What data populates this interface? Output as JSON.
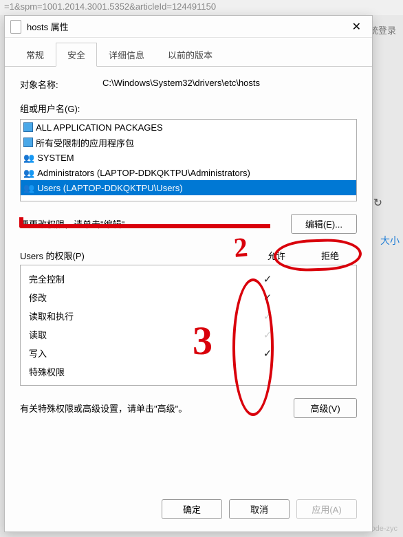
{
  "url_fragment": "=1&spm=1001.2014.3001.5352&articleId=124491150",
  "bg_login": "统登录",
  "bg_refresh_icon": "↻",
  "bg_size": "大小",
  "watermark": "CSDN @Code-zyc",
  "dialog": {
    "title": "hosts 属性",
    "close": "✕",
    "tabs": [
      {
        "label": "常规",
        "active": false
      },
      {
        "label": "安全",
        "active": true
      },
      {
        "label": "详细信息",
        "active": false
      },
      {
        "label": "以前的版本",
        "active": false
      }
    ],
    "object_label": "对象名称:",
    "object_value": "C:\\Windows\\System32\\drivers\\etc\\hosts",
    "group_label": "组或用户名(G):",
    "groups": [
      {
        "name": "ALL APPLICATION PACKAGES",
        "icon": "pkg",
        "selected": false
      },
      {
        "name": "所有受限制的应用程序包",
        "icon": "pkg",
        "selected": false
      },
      {
        "name": "SYSTEM",
        "icon": "user",
        "selected": false
      },
      {
        "name": "Administrators (LAPTOP-DDKQKTPU\\Administrators)",
        "icon": "user",
        "selected": false
      },
      {
        "name": "Users (LAPTOP-DDKQKTPU\\Users)",
        "icon": "user",
        "selected": true
      }
    ],
    "edit_hint": "要更改权限，请单击\"编辑\"。",
    "edit_btn": "编辑(E)...",
    "perm_title": "Users 的权限(P)",
    "allow_col": "允许",
    "deny_col": "拒绝",
    "permissions": [
      {
        "name": "完全控制",
        "allow": "dark",
        "deny": ""
      },
      {
        "name": "修改",
        "allow": "dark",
        "deny": ""
      },
      {
        "name": "读取和执行",
        "allow": "light",
        "deny": ""
      },
      {
        "name": "读取",
        "allow": "light",
        "deny": ""
      },
      {
        "name": "写入",
        "allow": "dark",
        "deny": ""
      },
      {
        "name": "特殊权限",
        "allow": "",
        "deny": ""
      }
    ],
    "adv_hint": "有关特殊权限或高级设置，请单击\"高级\"。",
    "adv_btn": "高级(V)",
    "ok_btn": "确定",
    "cancel_btn": "取消",
    "apply_btn": "应用(A)"
  },
  "annotations": {
    "num2": "2",
    "num3": "3"
  }
}
